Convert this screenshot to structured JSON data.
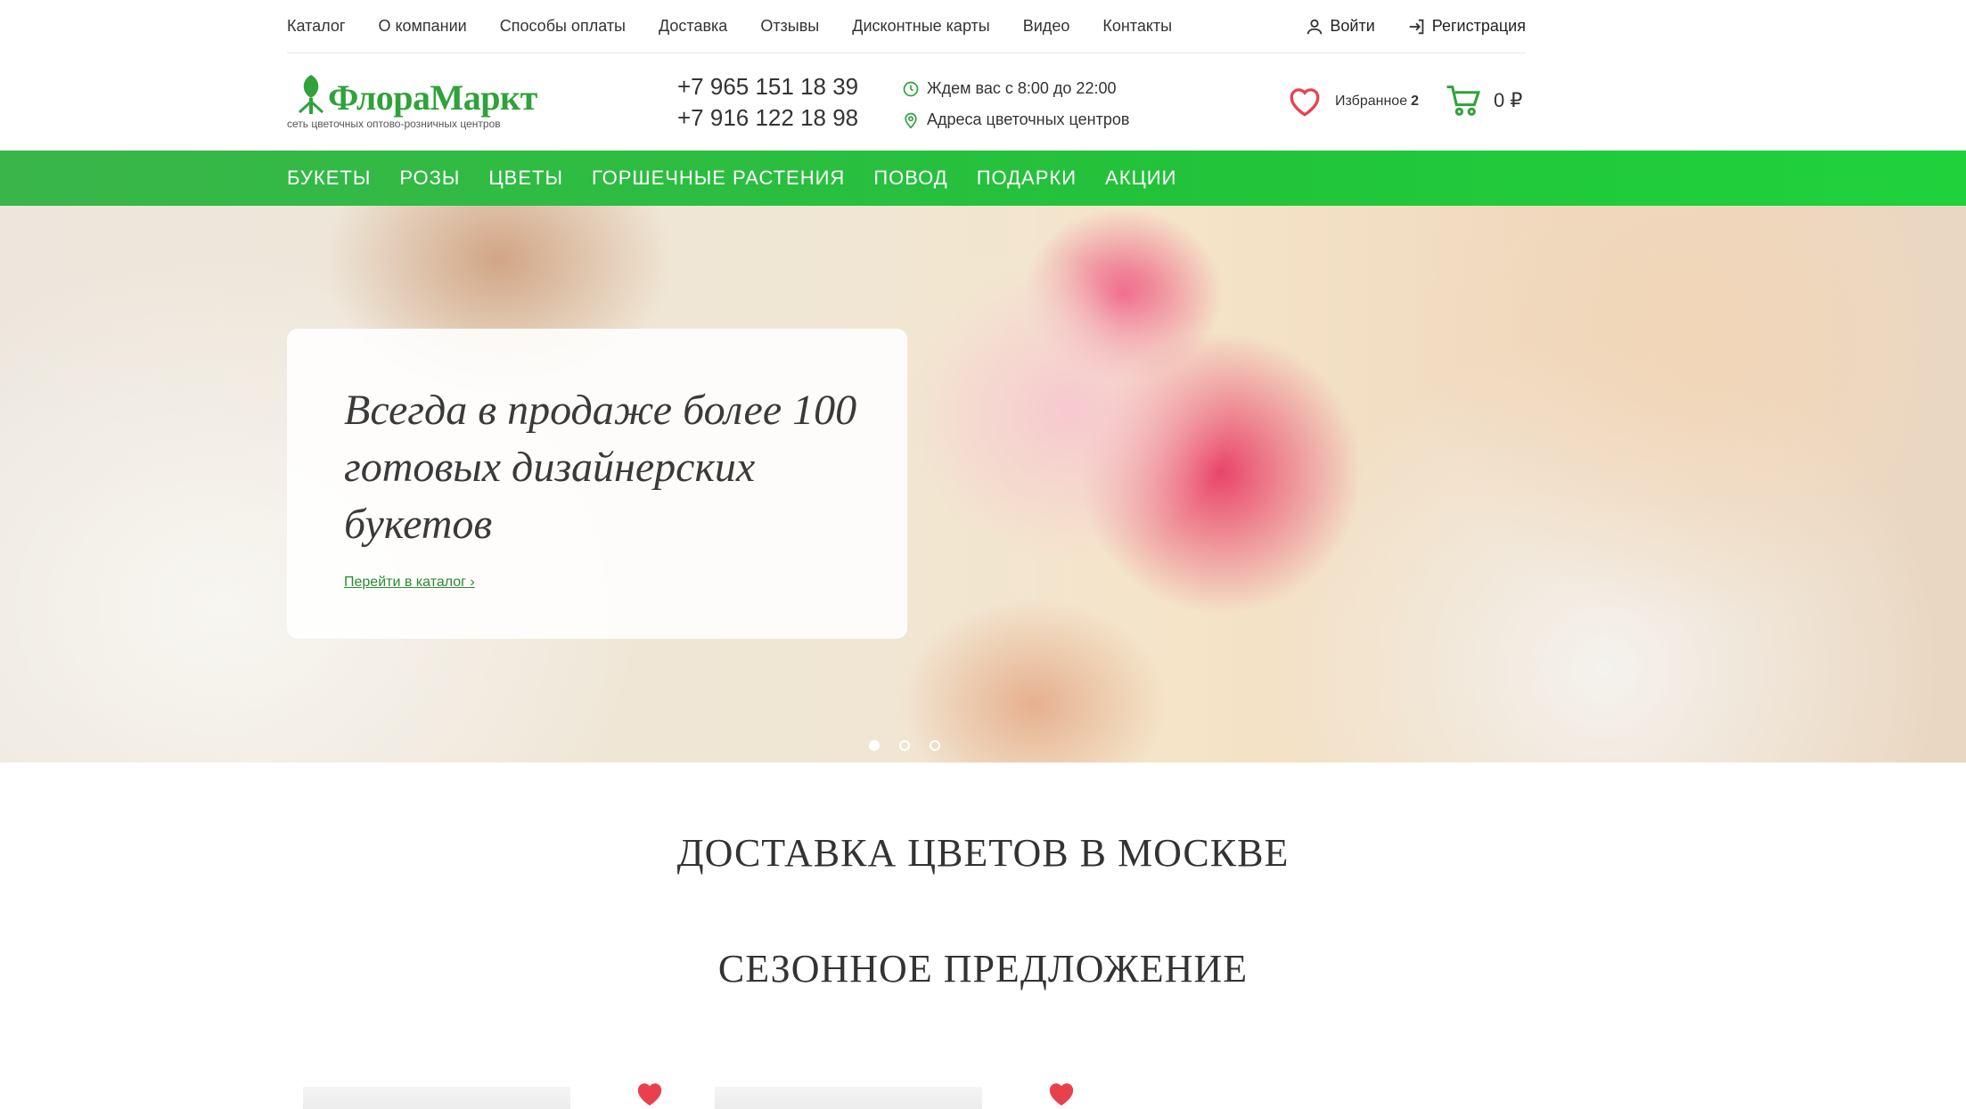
{
  "topnav": {
    "links": [
      "Каталог",
      "О компании",
      "Способы оплаты",
      "Доставка",
      "Отзывы",
      "Дисконтные карты",
      "Видео",
      "Контакты"
    ],
    "login": "Войти",
    "register": "Регистрация"
  },
  "header": {
    "logo_text": "ФлораМаркт",
    "logo_sub": "сеть цветочных оптово-розничных центров",
    "phones": [
      "+7 965 151 18 39",
      "+7 916 122 18 98"
    ],
    "hours": "Ждем вас с 8:00 до 22:00",
    "addresses": "Адреса цветочных центров",
    "favorites_label": "Избранное",
    "favorites_count": "2",
    "cart_total": "0 ₽"
  },
  "menu": [
    "БУКЕТЫ",
    "РОЗЫ",
    "ЦВЕТЫ",
    "ГОРШЕЧНЫЕ РАСТЕНИЯ",
    "ПОВОД",
    "ПОДАРКИ",
    "АКЦИИ"
  ],
  "hero": {
    "title": "Всегда в продаже более 100 готовых дизайнерских букетов",
    "link": "Перейти в каталог ›",
    "slides": 3,
    "active_slide": 1
  },
  "sections": {
    "delivery_title": "ДОСТАВКА ЦВЕТОВ В МОСКВЕ",
    "seasonal_title": "СЕЗОННОЕ ПРЕДЛОЖЕНИЕ"
  },
  "colors": {
    "brand_green": "#2fa23a",
    "menu_green": "#22c33a",
    "heart_red": "#e8414d"
  }
}
